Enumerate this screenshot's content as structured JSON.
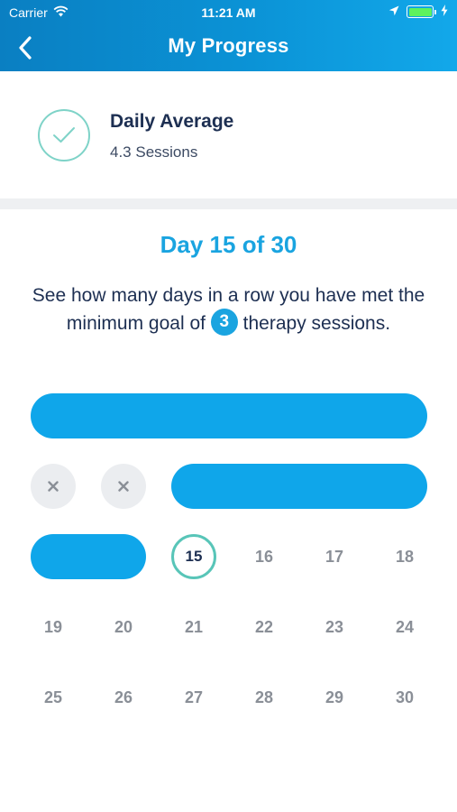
{
  "status_bar": {
    "carrier": "Carrier",
    "time": "11:21 AM"
  },
  "nav": {
    "title": "My Progress"
  },
  "daily_average": {
    "title": "Daily Average",
    "value": "4.3 Sessions"
  },
  "progress": {
    "title": "Day 15 of 30",
    "description_before": "See how many days in a row you have met the minimum goal of",
    "goal": "3",
    "description_after": "therapy sessions.",
    "today": "15",
    "upcoming_days": [
      "16",
      "17",
      "18",
      "19",
      "20",
      "21",
      "22",
      "23",
      "24",
      "25",
      "26",
      "27",
      "28",
      "29",
      "30"
    ]
  },
  "colors": {
    "header_gradient_start": "#0a7fc2",
    "header_gradient_end": "#12a8ea",
    "accent_blue": "#1aa4e0",
    "streak_blue": "#0fa6ea",
    "teal": "#58c5b8",
    "navy_text": "#1d2f52",
    "missed_grey": "#ebedf0"
  },
  "icons": {
    "back": "chevron-left-icon",
    "check": "check-icon",
    "missed": "x-icon",
    "wifi": "wifi-icon",
    "location": "location-arrow-icon",
    "battery": "battery-icon",
    "charging": "lightning-icon"
  }
}
